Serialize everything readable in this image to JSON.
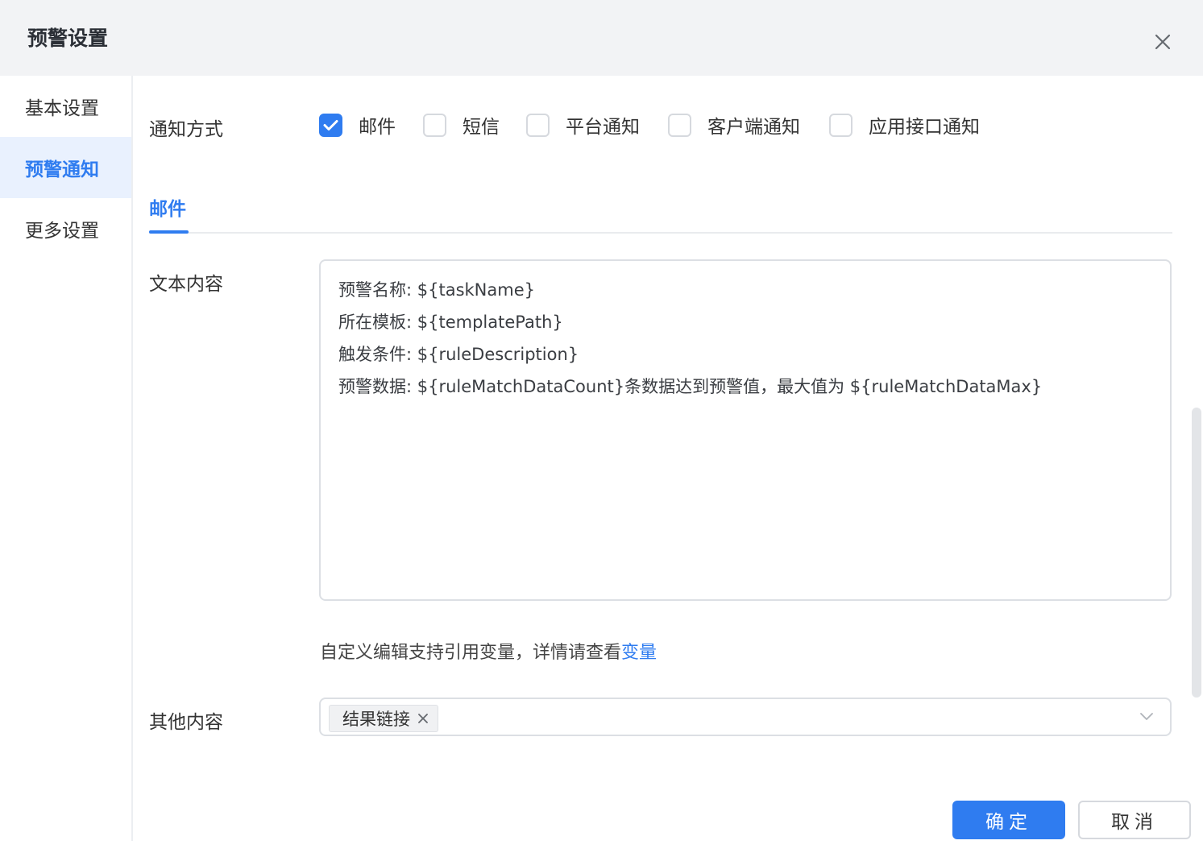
{
  "dialog": {
    "title": "预警设置"
  },
  "sidebar": {
    "items": [
      {
        "label": "基本设置",
        "active": false
      },
      {
        "label": "预警通知",
        "active": true
      },
      {
        "label": "更多设置",
        "active": false
      }
    ]
  },
  "notify": {
    "label": "通知方式",
    "options": [
      {
        "label": "邮件",
        "checked": true
      },
      {
        "label": "短信",
        "checked": false
      },
      {
        "label": "平台通知",
        "checked": false
      },
      {
        "label": "客户端通知",
        "checked": false
      },
      {
        "label": "应用接口通知",
        "checked": false
      }
    ]
  },
  "tabs": {
    "active": "邮件"
  },
  "content": {
    "label": "文本内容",
    "lines": [
      "预警名称: ${taskName}",
      "所在模板: ${templatePath}",
      "触发条件: ${ruleDescription}",
      "预警数据: ${ruleMatchDataCount}条数据达到预警值，最大值为 ${ruleMatchDataMax}"
    ],
    "hint": "自定义编辑支持引用变量，详情请查看",
    "hint_link": "变量"
  },
  "other": {
    "label": "其他内容",
    "tags": [
      "结果链接"
    ]
  },
  "footer": {
    "ok": "确定",
    "cancel": "取消"
  },
  "colors": {
    "accent": "#2f7cf0",
    "header_bg": "#f2f3f5",
    "active_bg": "#e9f1fe"
  }
}
